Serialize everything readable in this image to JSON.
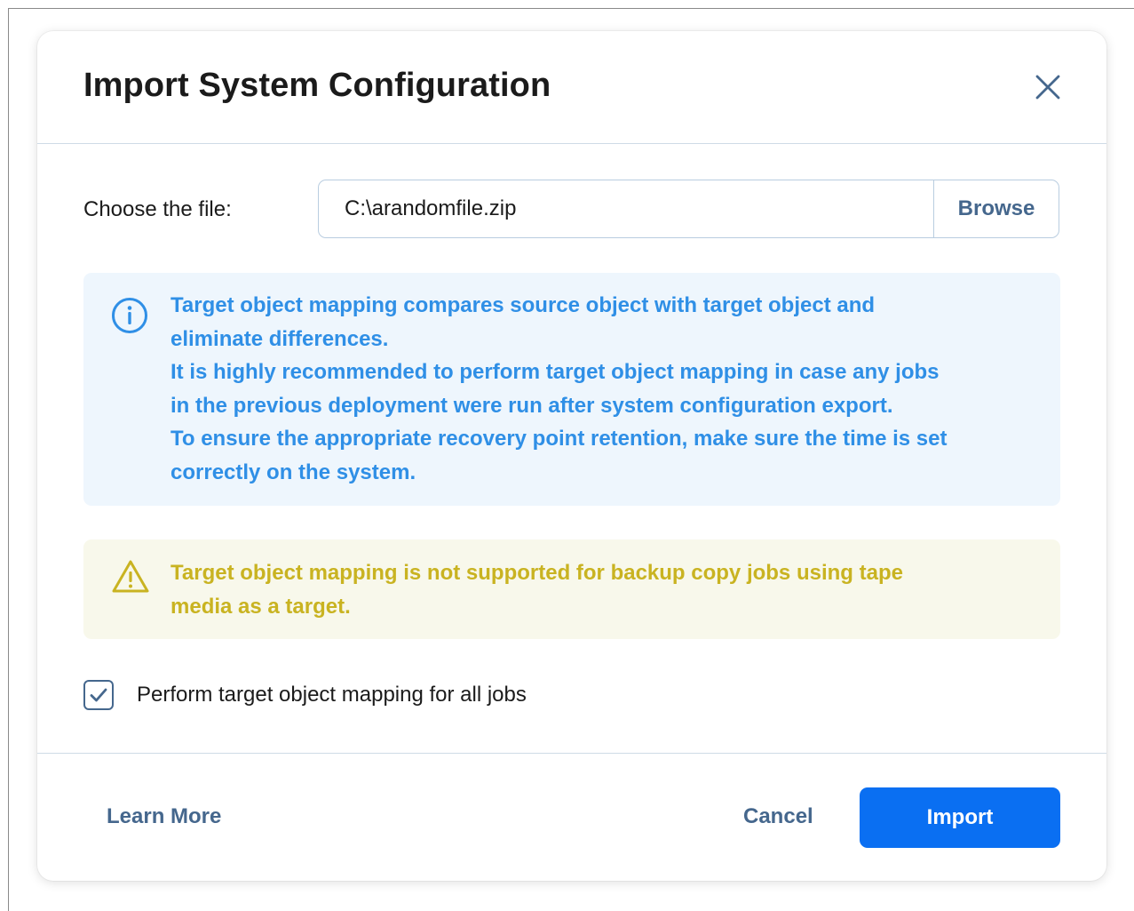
{
  "dialog": {
    "title": "Import System Configuration",
    "close_icon": "close-icon"
  },
  "file": {
    "label": "Choose the file:",
    "value": "C:\\arandomfile.zip",
    "browse_label": "Browse"
  },
  "info": {
    "icon": "info-icon",
    "color": "#2f8fe6",
    "lines": [
      "Target object mapping compares source object with target object and",
      "eliminate differences.",
      "It is highly recommended to perform target object mapping in case any jobs",
      "in the previous deployment were run after system configuration export.",
      "To ensure the appropriate recovery point retention, make sure the time is set",
      "correctly on the system."
    ]
  },
  "warning": {
    "icon": "warning-icon",
    "color": "#c9b321",
    "lines": [
      "Target object mapping is not supported for backup copy jobs using tape",
      "media as a target."
    ]
  },
  "option": {
    "checked": true,
    "label": "Perform target object mapping for all jobs"
  },
  "footer": {
    "learn_more": "Learn More",
    "cancel": "Cancel",
    "import": "Import"
  },
  "colors": {
    "accent": "#0a6ff2",
    "link": "#45678d"
  }
}
